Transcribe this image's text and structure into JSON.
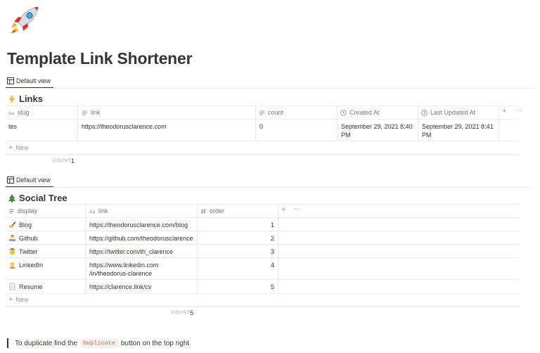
{
  "page": {
    "title": "Template Link Shortener",
    "icon": "rocket-icon"
  },
  "links_db": {
    "view_tab": "Default view",
    "title": "Links",
    "title_icon": "lightning-icon",
    "columns": [
      {
        "label": "slug",
        "icon": "text-type-icon"
      },
      {
        "label": "link",
        "icon": "list-lines-icon"
      },
      {
        "label": "count",
        "icon": "list-lines-icon"
      },
      {
        "label": "Created At",
        "icon": "clock-icon"
      },
      {
        "label": "Last Updated At",
        "icon": "clock-icon"
      }
    ],
    "rows": [
      {
        "slug": "tes",
        "link": "https://theodorusclarence.com",
        "count": "0",
        "created_1": "September 29, 2021 8:40",
        "created_2": "PM",
        "updated_1": "September 29, 2021 8:41",
        "updated_2": "PM"
      }
    ],
    "new_label": "New",
    "count_label": "COUNT",
    "count_value": "1"
  },
  "social_db": {
    "view_tab": "Default view",
    "title": "Social Tree",
    "title_icon": "tree-icon",
    "columns": [
      {
        "label": "display",
        "icon": "list-lines-icon"
      },
      {
        "label": "link",
        "icon": "text-type-icon"
      },
      {
        "label": "order",
        "icon": "hash-icon"
      }
    ],
    "rows": [
      {
        "display": "Blog",
        "icon": "writing-hand-icon",
        "link": "https://theodorusclarence.com/blog",
        "order": "1"
      },
      {
        "display": "Github",
        "icon": "technologist-icon",
        "link": "https://github.com/theodorusclarence",
        "order": "2"
      },
      {
        "display": "Twitter",
        "icon": "cowboy-face-icon",
        "link": "https://twitter.com/th_clarence",
        "order": "3"
      },
      {
        "display": "LinkedIn",
        "icon": "construction-worker-icon",
        "link_1": "https://www.linkedin.com",
        "link_2": "/in/theodorus-clarence",
        "order": "4"
      },
      {
        "display": "Resume",
        "icon": "page-icon",
        "link": "https://clarence.link/cv",
        "order": "5"
      }
    ],
    "new_label": "New",
    "count_label": "COUNT",
    "count_value": "5"
  },
  "callout": {
    "before": "To duplicate find the",
    "code": "Duplicate",
    "after": "button on the top right"
  },
  "colors": {
    "text": "#37352f",
    "muted": "#787774",
    "border": "#e9e9e7",
    "code_red": "#eb5757"
  }
}
